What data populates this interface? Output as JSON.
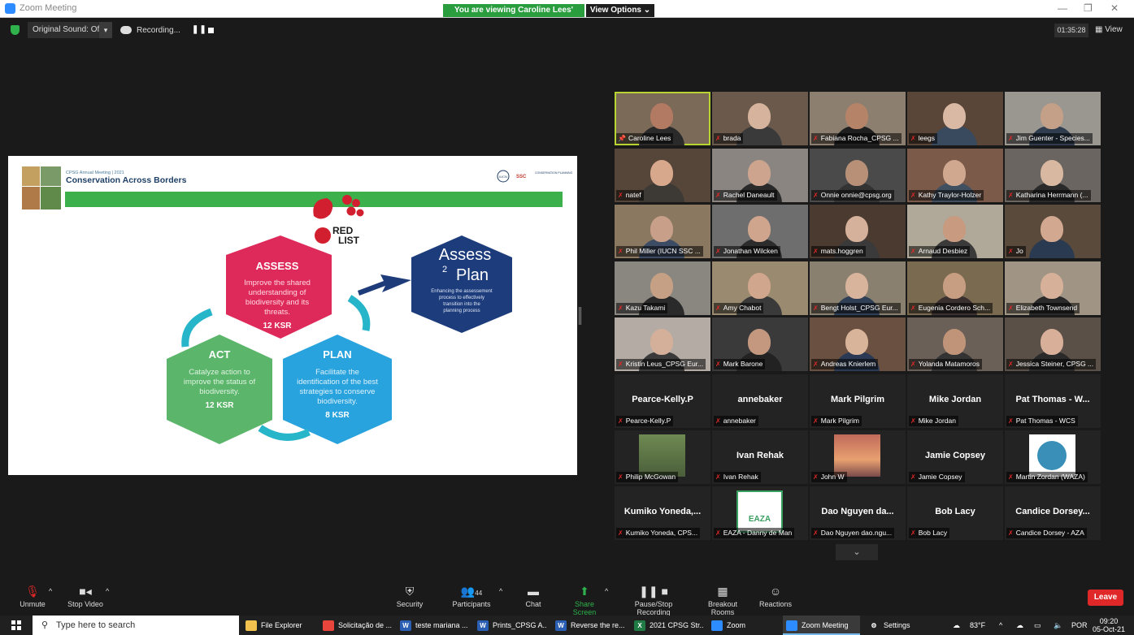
{
  "window": {
    "title": "Zoom Meeting",
    "share_banner": "You are viewing Caroline Lees' screen",
    "view_options": "View Options ⌄"
  },
  "topbar": {
    "original_sound": "Original Sound: Off",
    "recording": "Recording...",
    "timer": "01:35:28",
    "view": "View"
  },
  "slide": {
    "header_small": "CPSG Annual Meeting | 2021",
    "header_title": "Conservation Across Borders",
    "iucn": "IUCN",
    "ssc": "SSC",
    "logo_small": "CONSERVATION PLANNING",
    "red_list_top": "RED",
    "red_list_bottom": "LIST",
    "assess_title": "ASSESS",
    "assess_text": "Improve the shared understanding of biodiversity and its threats.",
    "assess_ksr": "12 KSR",
    "act_title": "ACT",
    "act_text": "Catalyze action to improve the status of biodiversity.",
    "act_ksr": "12 KSR",
    "plan_title": "PLAN",
    "plan_text": "Facilitate the identification of the best strategies to conserve biodiversity.",
    "plan_ksr": "8 KSR",
    "a2p_line1": "Assess",
    "a2p_line2": "Plan",
    "a2p_sup": "2",
    "a2p_text": "Enhancing the assessement process to effectively transition into the planning process"
  },
  "participants_grid": [
    {
      "label": "Caroline Lees",
      "video": true,
      "active": true,
      "pinned": true,
      "skin": "#b27a62",
      "shirt": "#2a2a2a",
      "bg": "#7b6a58"
    },
    {
      "label": "brada",
      "video": true,
      "skin": "#d5b39c",
      "shirt": "#3a3a3a",
      "bg": "#6b5a4c"
    },
    {
      "label": "Fabiana Rocha_CPSG ...",
      "video": true,
      "skin": "#b58468",
      "shirt": "#1f1f1f",
      "bg": "#8c7f6f"
    },
    {
      "label": "leegs",
      "video": true,
      "skin": "#d9b9a4",
      "shirt": "#3a4a5e",
      "bg": "#5a4638"
    },
    {
      "label": "Jim Guenter - Species...",
      "video": true,
      "skin": "#c4a088",
      "shirt": "#2f3d4e",
      "bg": "#9a9690"
    },
    {
      "label": "natef",
      "video": true,
      "skin": "#d8a88c",
      "shirt": "#3d3a36",
      "bg": "#56463a"
    },
    {
      "label": "Rachel Daneault",
      "video": true,
      "skin": "#cda58e",
      "shirt": "#2a2a2a",
      "bg": "#8a8580"
    },
    {
      "label": "Onnie onnie@cpsg.org",
      "video": true,
      "skin": "#b89078",
      "shirt": "#333",
      "bg": "#4a4a4a"
    },
    {
      "label": "Kathy Traylor-Holzer",
      "video": true,
      "skin": "#d0a890",
      "shirt": "#405060",
      "bg": "#7b5a4a"
    },
    {
      "label": "Katharina Herrmann (...",
      "video": true,
      "skin": "#d8b8a0",
      "shirt": "#2a2a2a",
      "bg": "#6a6560"
    },
    {
      "label": "Phil Miller (IUCN SSC ...",
      "video": true,
      "skin": "#c8a08a",
      "shirt": "#3c4c64",
      "bg": "#8a7860"
    },
    {
      "label": "Jonathan Wilcken",
      "video": true,
      "skin": "#cfa58e",
      "shirt": "#2c2c2c",
      "bg": "#6e6e6e"
    },
    {
      "label": "mats.hoggren",
      "video": true,
      "skin": "#d5b09a",
      "shirt": "#3a3a3a",
      "bg": "#4a3a30"
    },
    {
      "label": "Arnaud Desbiez",
      "video": true,
      "skin": "#c89a80",
      "shirt": "#3a3a3a",
      "bg": "#b0a898"
    },
    {
      "label": "Jo",
      "video": true,
      "skin": "#d2a890",
      "shirt": "#2a3a50",
      "bg": "#5a4a3c"
    },
    {
      "label": "Kazu Takami",
      "video": true,
      "skin": "#c6a084",
      "shirt": "#2a2a2a",
      "bg": "#8a8680"
    },
    {
      "label": "Amy Chabot",
      "video": true,
      "skin": "#d0a68c",
      "shirt": "#3a3a3a",
      "bg": "#9a8a70"
    },
    {
      "label": "Bengt Holst_CPSG Eur...",
      "video": true,
      "skin": "#d8b49c",
      "shirt": "#2f3f55",
      "bg": "#8a8070"
    },
    {
      "label": "Eugenia Cordero Sch...",
      "video": true,
      "skin": "#c89e82",
      "shirt": "#3a3030",
      "bg": "#7a6a50"
    },
    {
      "label": "Elizabeth Townsend",
      "video": true,
      "skin": "#d6b098",
      "shirt": "#2a2a2a",
      "bg": "#a09484"
    },
    {
      "label": "Kristin Leus_CPSG Eur...",
      "video": true,
      "skin": "#d4b09a",
      "shirt": "#3a3a3a",
      "bg": "#b4aca4"
    },
    {
      "label": "Mark Barone",
      "video": true,
      "skin": "#c4987e",
      "shirt": "#222",
      "bg": "#3a3a3a"
    },
    {
      "label": "Andreas Knierlem",
      "video": true,
      "skin": "#d8b49a",
      "shirt": "#2a3a55",
      "bg": "#6a5040"
    },
    {
      "label": "Yolanda Matamoros",
      "video": true,
      "skin": "#c09478",
      "shirt": "#333",
      "bg": "#6a6058"
    },
    {
      "label": "Jessica Steiner, CPSG ...",
      "video": true,
      "skin": "#d8b09a",
      "shirt": "#2a2a2a",
      "bg": "#5a5048"
    },
    {
      "label": "Pearce-Kelly.P",
      "video": false,
      "bigname": "Pearce-Kelly.P"
    },
    {
      "label": "annebaker",
      "video": false,
      "bigname": "annebaker"
    },
    {
      "label": "Mark Pilgrim",
      "video": false,
      "bigname": "Mark Pilgrim"
    },
    {
      "label": "Mike Jordan",
      "video": false,
      "bigname": "Mike Jordan"
    },
    {
      "label": "Pat Thomas - WCS",
      "video": false,
      "bigname": "Pat Thomas - W..."
    },
    {
      "label": "Philip McGowan",
      "video": false,
      "photo": "portrait"
    },
    {
      "label": "Ivan Rehak",
      "video": false,
      "bigname": "Ivan Rehak"
    },
    {
      "label": "John W",
      "video": false,
      "photo": "sunset"
    },
    {
      "label": "Jamie Copsey",
      "video": false,
      "bigname": "Jamie Copsey"
    },
    {
      "label": "Martin Zordan (WAZA)",
      "video": false,
      "photo": "waza"
    },
    {
      "label": "Kumiko Yoneda, CPS...",
      "video": false,
      "bigname": "Kumiko Yoneda,..."
    },
    {
      "label": "EAZA - Danny de Man",
      "video": false,
      "photo": "eaza",
      "photo_text": "EAZA"
    },
    {
      "label": "Dao Nguyen dao.ngu...",
      "video": false,
      "bigname": "Dao Nguyen da..."
    },
    {
      "label": "Bob Lacy",
      "video": false,
      "bigname": "Bob Lacy"
    },
    {
      "label": "Candice Dorsey - AZA",
      "video": false,
      "bigname": "Candice Dorsey..."
    }
  ],
  "toolbar": {
    "unmute": "Unmute",
    "stop_video": "Stop Video",
    "security": "Security",
    "participants": "Participants",
    "participants_count": "44",
    "chat": "Chat",
    "share_screen": "Share Screen",
    "pause_stop_recording": "Pause/Stop Recording",
    "breakout_rooms": "Breakout Rooms",
    "reactions": "Reactions",
    "leave": "Leave"
  },
  "taskbar": {
    "search_placeholder": "Type here to search",
    "items": [
      {
        "label": "File Explorer",
        "color": "#f2c14e",
        "glyph": ""
      },
      {
        "label": "Solicitação de ...",
        "color": "#e8453c",
        "glyph": ""
      },
      {
        "label": "teste mariana ...",
        "color": "#2b5fb4",
        "glyph": "W"
      },
      {
        "label": "Prints_CPSG A...",
        "color": "#2b5fb4",
        "glyph": "W"
      },
      {
        "label": "Reverse the re...",
        "color": "#2b5fb4",
        "glyph": "W"
      },
      {
        "label": "2021 CPSG Str...",
        "color": "#1f7a44",
        "glyph": "X"
      },
      {
        "label": "Zoom",
        "color": "#2d8cff",
        "glyph": ""
      },
      {
        "label": "Zoom Meeting",
        "color": "#2d8cff",
        "glyph": "",
        "active": true
      },
      {
        "label": "Settings",
        "color": "#202020",
        "glyph": "⚙"
      }
    ],
    "temperature": "83°F",
    "language": "POR",
    "time": "09:20",
    "date": "05-Oct-21"
  }
}
